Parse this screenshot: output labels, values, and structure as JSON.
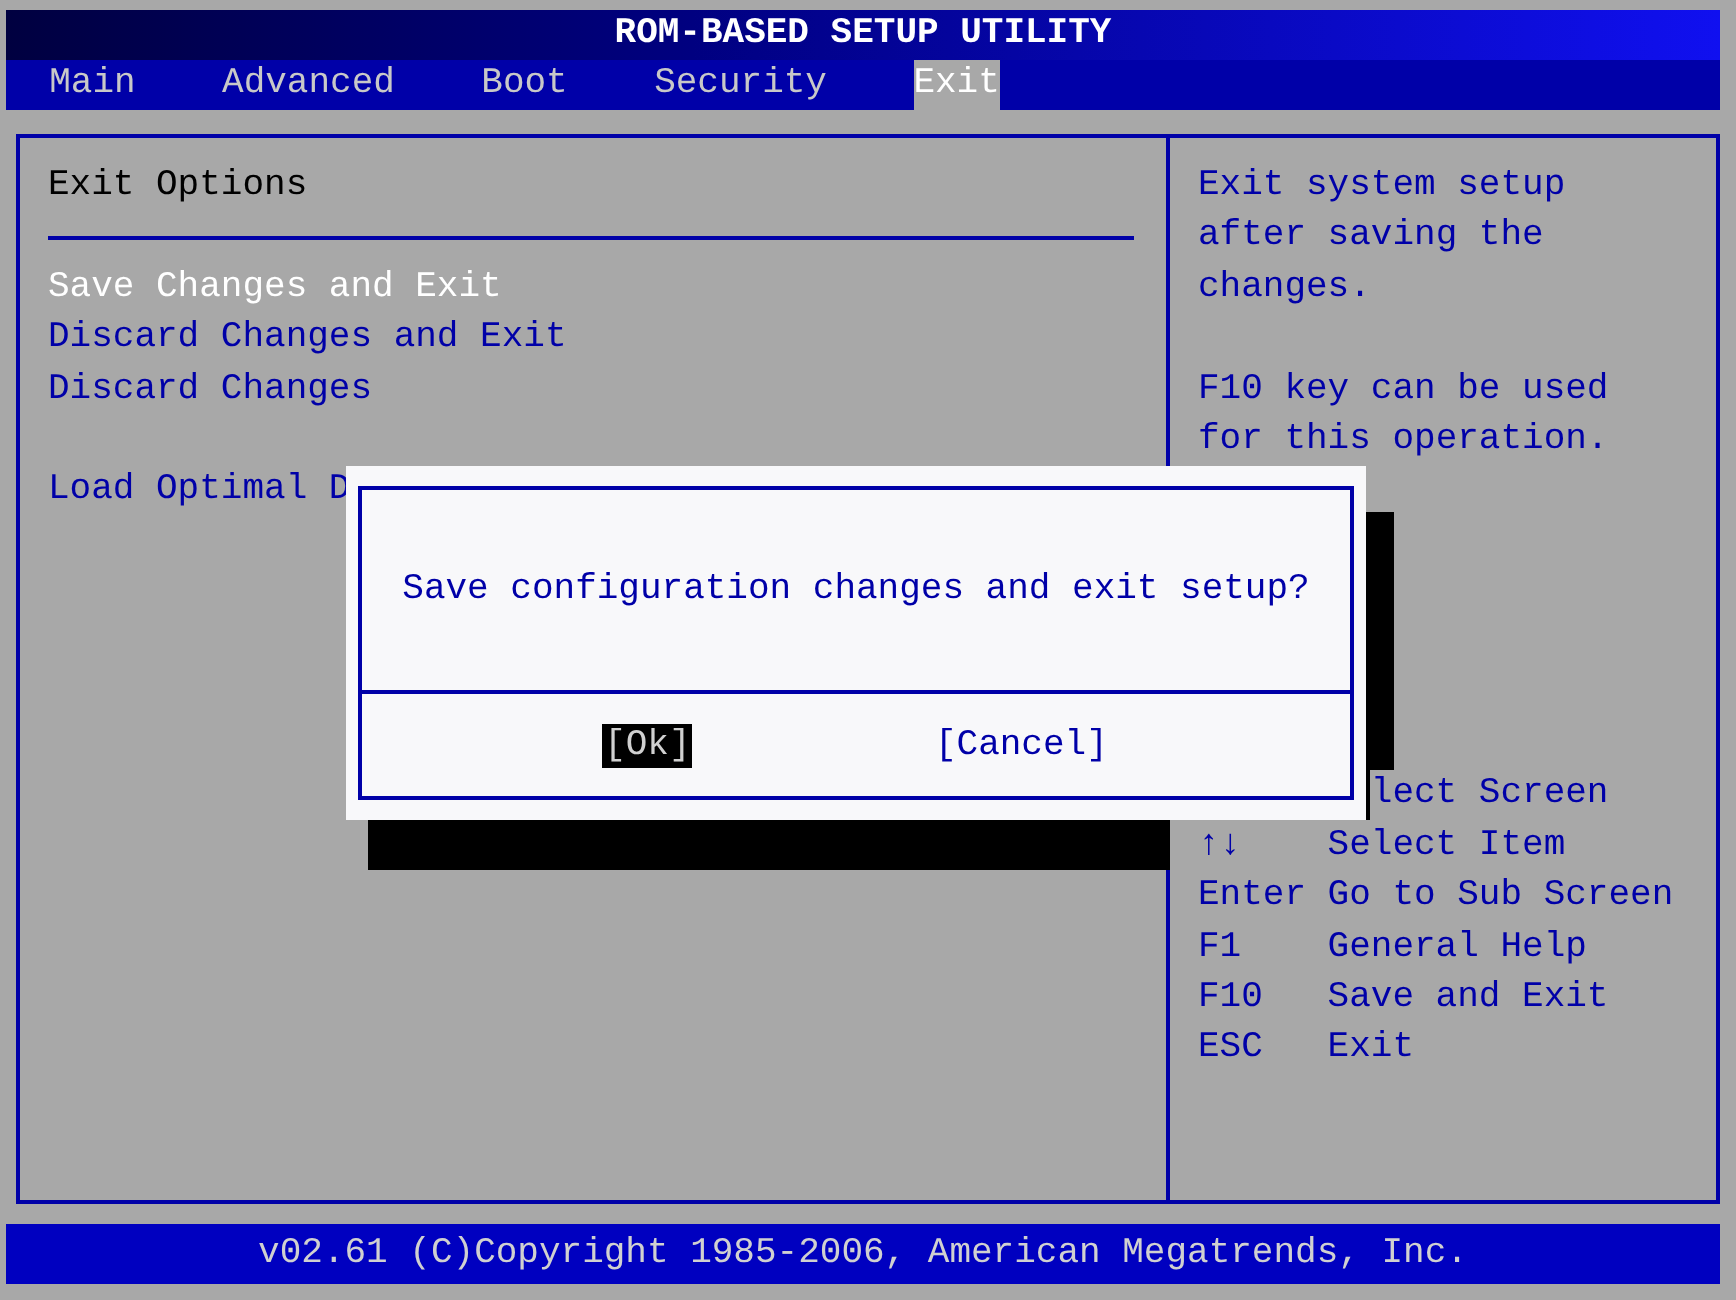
{
  "title": "ROM-BASED SETUP UTILITY",
  "tabs": [
    {
      "label": "Main",
      "selected": false
    },
    {
      "label": "Advanced",
      "selected": false
    },
    {
      "label": "Boot",
      "selected": false
    },
    {
      "label": "Security",
      "selected": false
    },
    {
      "label": "Exit",
      "selected": true
    }
  ],
  "panel": {
    "heading": "Exit Options",
    "groups": [
      [
        {
          "label": "Save Changes and Exit",
          "selected": true
        },
        {
          "label": "Discard Changes and Exit",
          "selected": false
        },
        {
          "label": "Discard Changes",
          "selected": false
        }
      ],
      [
        {
          "label": "Load Optimal D",
          "selected": false
        }
      ]
    ]
  },
  "help": {
    "paragraphs": [
      [
        "Exit system setup",
        "after saving the",
        "changes."
      ],
      [
        "F10 key can be used",
        "for this operation."
      ]
    ],
    "keys": [
      {
        "kind": "partial",
        "action": "lect Screen"
      },
      {
        "kind": "key",
        "key": "↑↓",
        "action": "Select Item"
      },
      {
        "kind": "key",
        "key": "Enter",
        "action": "Go to Sub Screen"
      },
      {
        "kind": "key",
        "key": "F1",
        "action": "General Help"
      },
      {
        "kind": "key",
        "key": "F10",
        "action": "Save and Exit"
      },
      {
        "kind": "key",
        "key": "ESC",
        "action": "Exit"
      }
    ]
  },
  "dialog": {
    "message": "Save configuration changes and exit setup?",
    "buttons": [
      {
        "label": "[Ok]",
        "selected": true
      },
      {
        "label": "[Cancel]",
        "selected": false
      }
    ]
  },
  "footer": "v02.61 (C)Copyright 1985-2006, American Megatrends, Inc."
}
